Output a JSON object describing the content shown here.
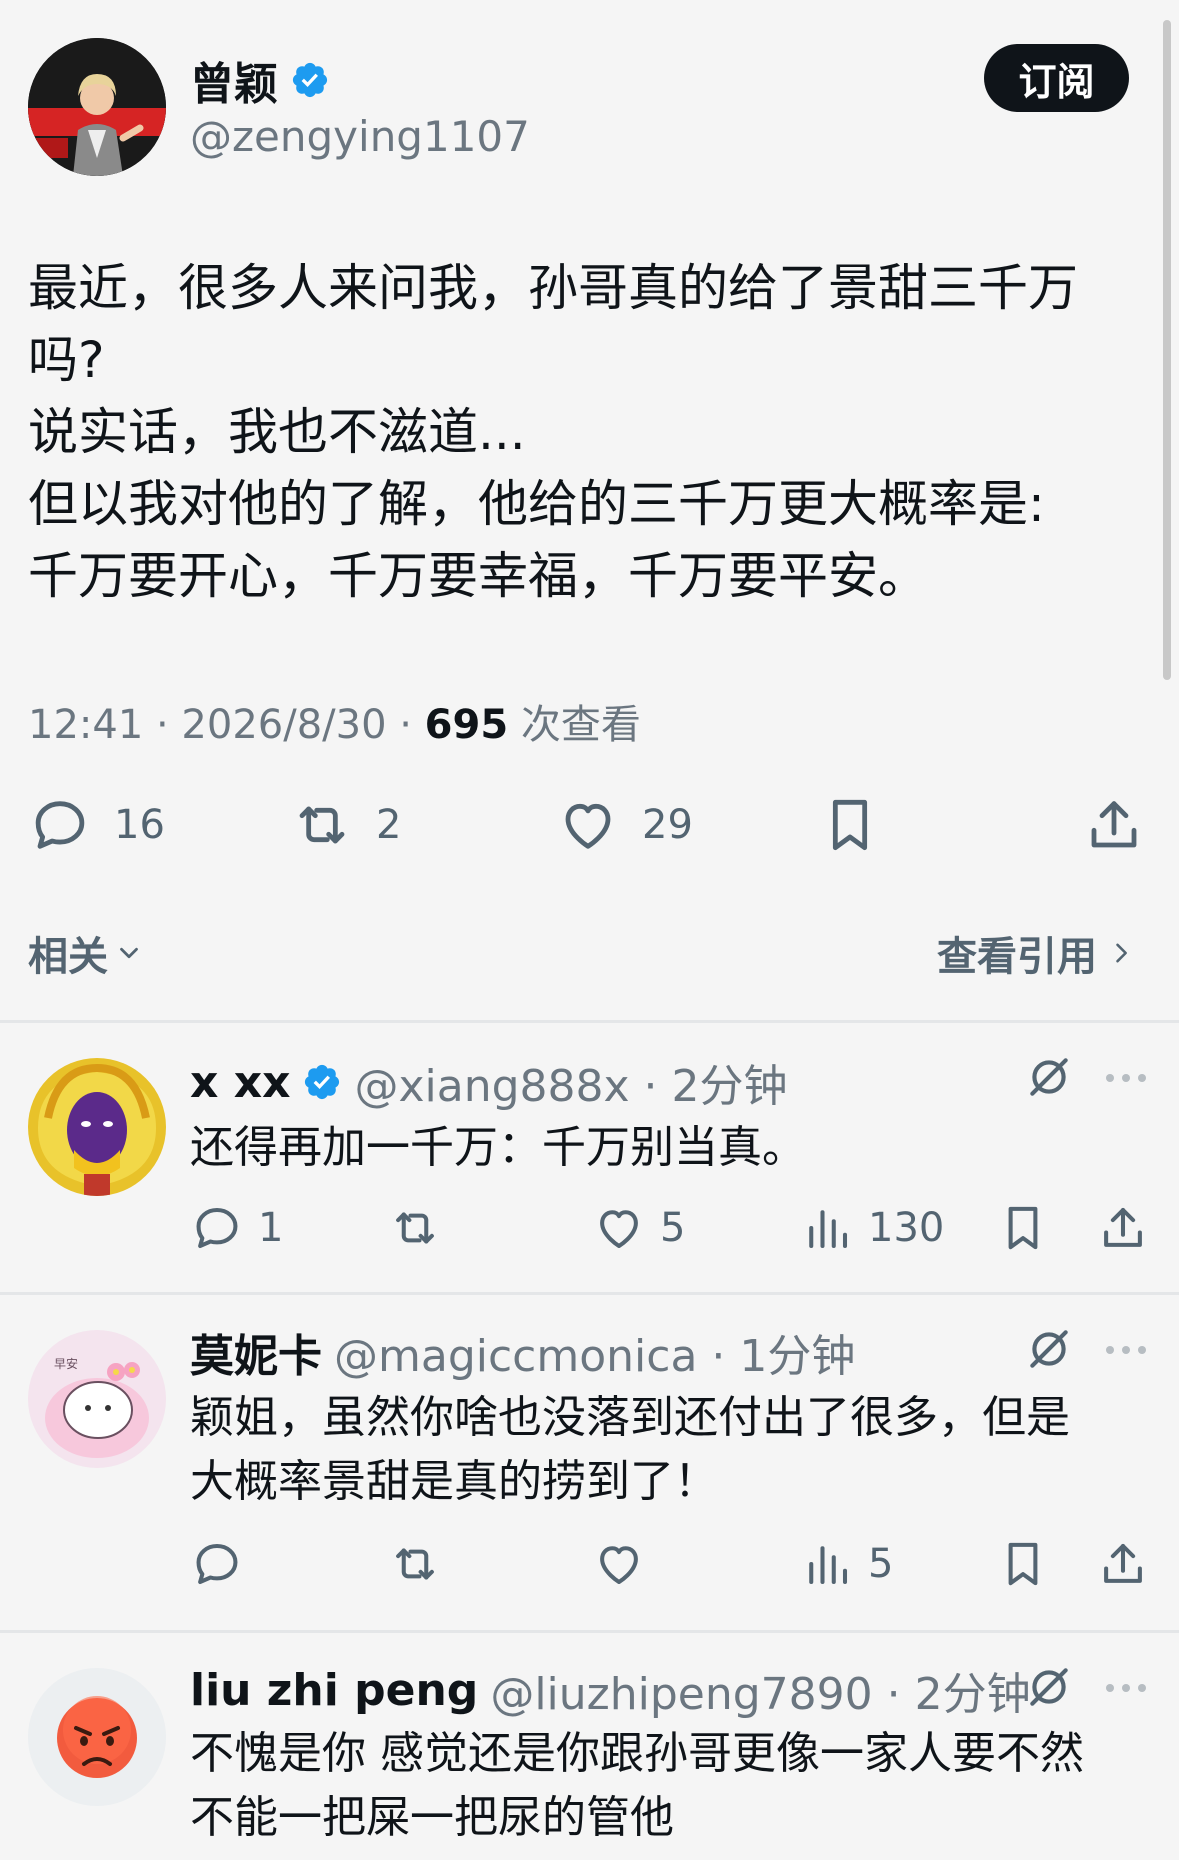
{
  "main_tweet": {
    "author_name": "曾颖",
    "author_handle": "@zengying1107",
    "subscribe_label": "订阅",
    "text_lines": [
      "最近，很多人来问我，孙哥真的给了景甜三千万",
      "吗?",
      "说实话，我也不滋道...",
      "但以我对他的了解，他给的三千万更大概率是:",
      "千万要开心，千万要幸福，千万要平安。"
    ],
    "time": "12:41 · 2026/8/30 · ",
    "views": "695",
    "views_suffix": " 次查看",
    "counts": {
      "replies": "16",
      "retweets": "2",
      "likes": "29"
    },
    "related_label": "相关",
    "view_quotes_label": "查看引用"
  },
  "replies": [
    {
      "name": "x xx",
      "handle": "@xiang888x · 2分钟",
      "verified": true,
      "text_lines": [
        "还得再加一千万：千万别当真。"
      ],
      "counts": {
        "replies": "1",
        "retweets": "",
        "likes": "5",
        "views": "130"
      }
    },
    {
      "name": "莫妮卡",
      "handle": "@magiccmonica · 1分钟",
      "verified": false,
      "text_lines": [
        "颖姐，虽然你啥也没落到还付出了很多，但是",
        "大概率景甜是真的捞到了！"
      ],
      "counts": {
        "replies": "",
        "retweets": "",
        "likes": "",
        "views": "5"
      }
    },
    {
      "name": "liu zhi peng",
      "handle": "@liuzhipeng7890 · 2分钟",
      "verified": false,
      "text_lines": [
        "不愧是你 感觉还是你跟孙哥更像一家人要不然",
        "不能一把屎一把尿的管他"
      ]
    }
  ],
  "colors": {
    "accent_blue": "#1d9bf0",
    "text_primary": "#0f1419",
    "text_secondary": "#536471",
    "background": "#f5f5f5"
  }
}
